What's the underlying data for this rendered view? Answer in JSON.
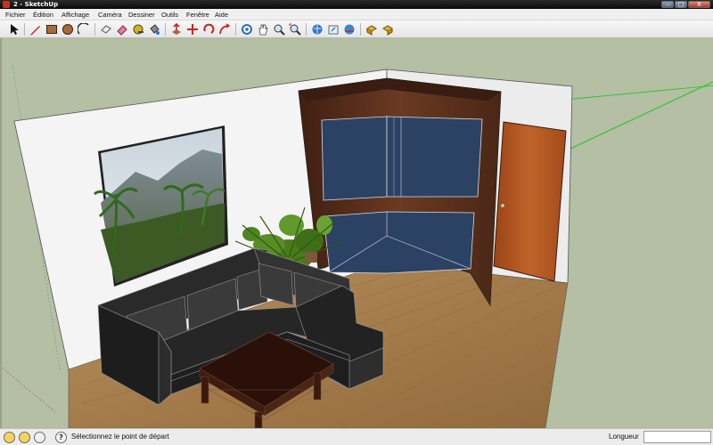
{
  "window": {
    "title": "2 - SketchUp",
    "minimize": "–",
    "maximize": "□",
    "close": "X"
  },
  "menu": [
    "Fichier",
    "Édition",
    "Affichage",
    "Caméra",
    "Dessiner",
    "Outils",
    "Fenêtre",
    "Aide"
  ],
  "toolbar": {
    "icons": [
      "select-icon",
      "pencil-line-icon",
      "rectangle-icon",
      "circle-icon",
      "arc-icon",
      "eraser-box-icon",
      "eraser-icon",
      "tape-measure-icon",
      "paint-bucket-icon",
      "push-pull-icon",
      "move-icon",
      "rotate-icon",
      "follow-me-icon",
      "orbit-icon",
      "pan-icon",
      "zoom-icon",
      "zoom-extents-icon",
      "get-models-icon",
      "share-model-icon",
      "3d-warehouse-icon",
      "components-icon",
      "share-component-icon"
    ]
  },
  "status": {
    "message": "Sélectionnez le point de départ",
    "measure_label": "Longueur",
    "measure_value": ""
  },
  "colors": {
    "sky": "#b4bfa3",
    "wall": "#f2f2f2",
    "floor": "#a9845a",
    "wood_dark": "#4a2818",
    "glass": "#2b4264",
    "door": "#b3561f",
    "sofa": "#2e2e2e",
    "axis_green": "#22c32a"
  }
}
